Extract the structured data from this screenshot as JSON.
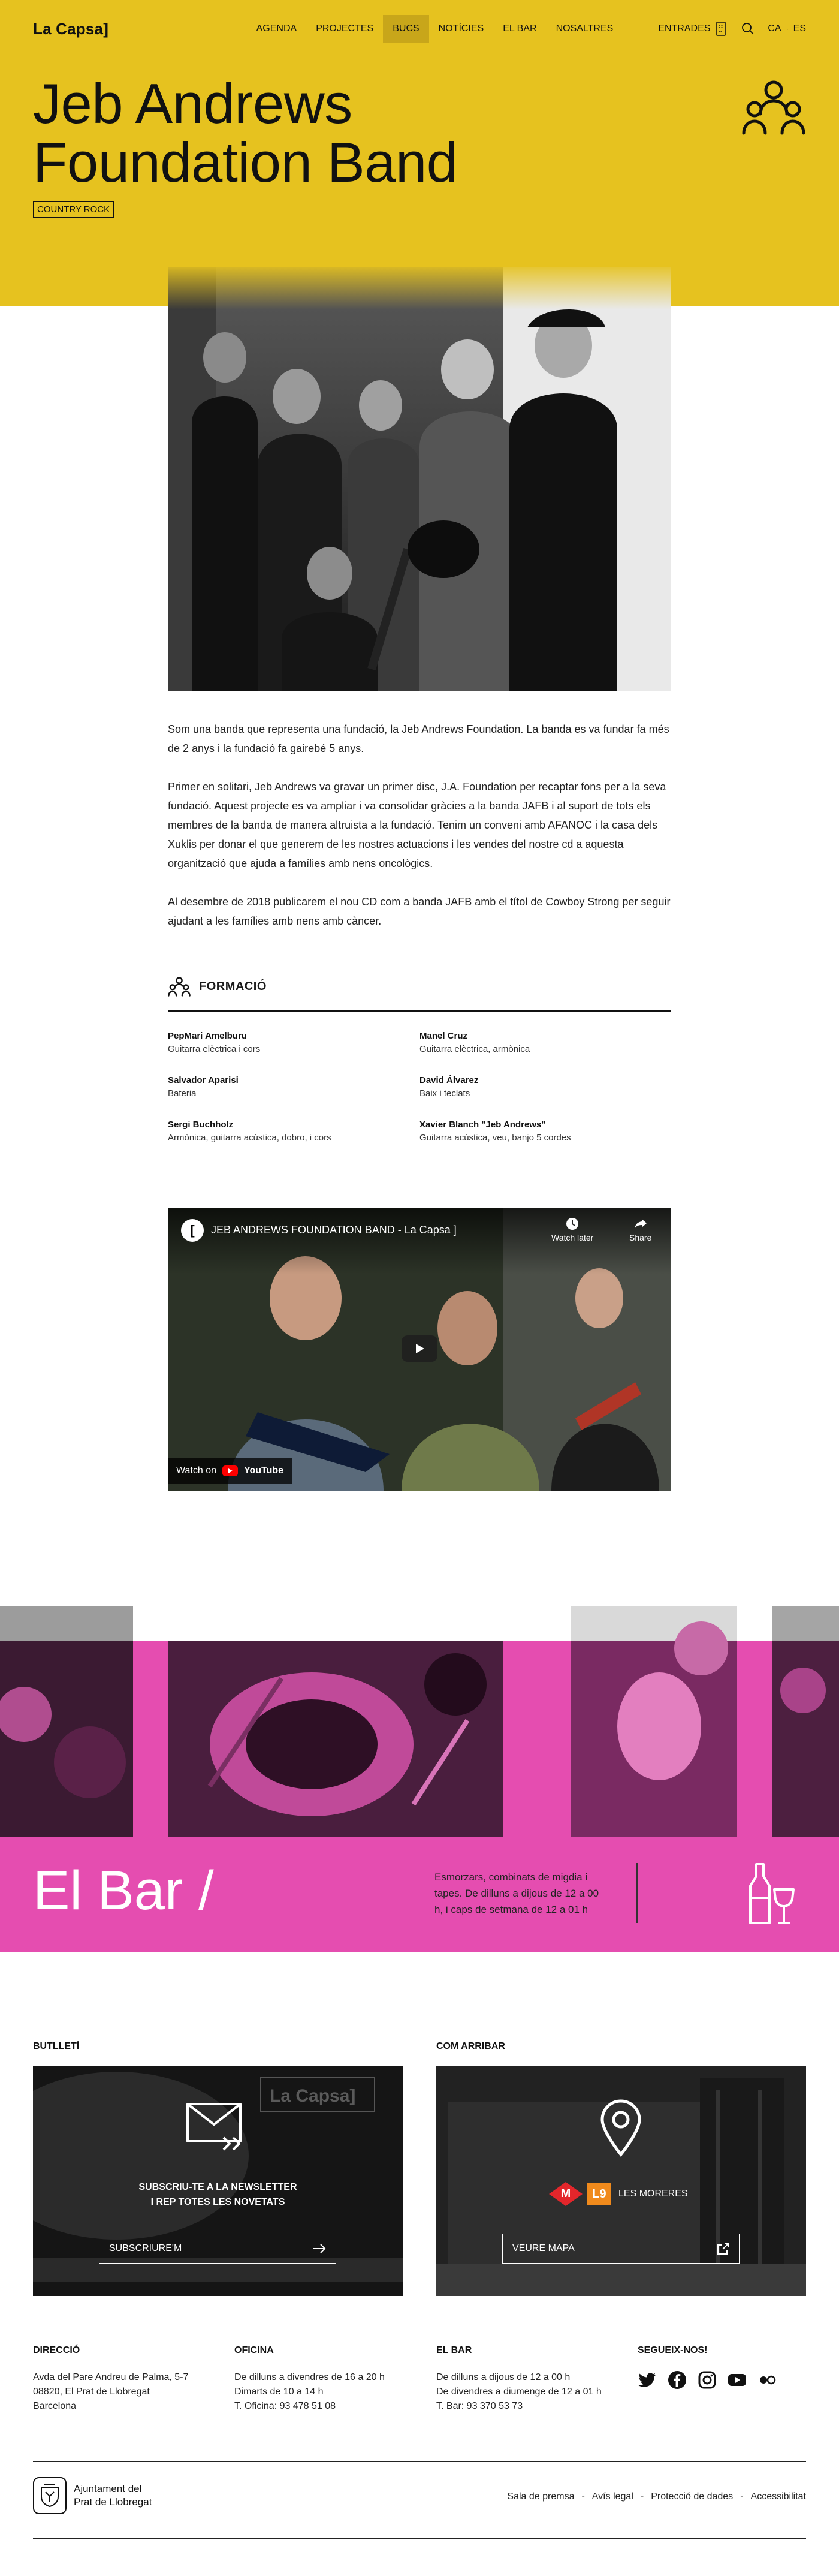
{
  "header": {
    "logo": "La Capsa]",
    "nav": [
      "AGENDA",
      "PROJECTES",
      "BUCS",
      "NOTÍCIES",
      "EL BAR",
      "NOSALTRES"
    ],
    "active_nav": "BUCS",
    "tickets_label": "ENTRADES",
    "lang_ca": "CA",
    "lang_sep": "·",
    "lang_es": "ES"
  },
  "hero": {
    "title_line1": "Jeb Andrews",
    "title_line2": "Foundation Band",
    "genre_tag": "COUNTRY ROCK"
  },
  "body": {
    "p1": "Som una banda que representa una fundació, la Jeb Andrews Foundation. La banda es va fundar fa més de 2 anys i la fundació fa gairebé 5 anys.",
    "p2": "Primer en solitari, Jeb Andrews va gravar un primer disc, J.A. Foundation per recaptar fons per a la seva fundació. Aquest projecte es va ampliar i va consolidar gràcies a la banda JAFB i al suport de tots els membres de la banda de manera altruista a la fundació. Tenim un conveni amb AFANOC i la casa dels Xuklis per donar el que generem de les nostres actuacions i les vendes del nostre cd a aquesta organització que ajuda a famílies amb nens oncològics.",
    "p3": "Al desembre de 2018 publicarem el nou CD com a banda JAFB amb el títol de Cowboy Strong per seguir ajudant a les famílies amb nens amb càncer."
  },
  "formacio": {
    "heading": "FORMACIÓ",
    "members": [
      {
        "name": "PepMari Amelburu",
        "role": "Guitarra elèctrica i cors"
      },
      {
        "name": "Manel Cruz",
        "role": "Guitarra elèctrica, armònica"
      },
      {
        "name": "Salvador Aparisi",
        "role": "Bateria"
      },
      {
        "name": "David Álvarez",
        "role": "Baix i teclats"
      },
      {
        "name": "Sergi Buchholz",
        "role": "Armònica, guitarra acústica, dobro, i cors"
      },
      {
        "name": "Xavier Blanch \"Jeb Andrews\"",
        "role": "Guitarra acústica, veu, banjo 5 cordes"
      }
    ]
  },
  "video": {
    "title": "JEB ANDREWS FOUNDATION BAND - La Capsa ]",
    "watch_later": "Watch later",
    "share": "Share",
    "watch_on": "Watch on",
    "youtube": "YouTube"
  },
  "el_bar": {
    "title": "El Bar /",
    "text": "Esmorzars, combinats de migdia i tapes. De dilluns a dijous de 12 a 00 h, i caps de setmana de 12 a 01 h",
    "icon": "bottle-glass-icon"
  },
  "newsletter": {
    "label": "BUTLLETÍ",
    "text_line1": "SUBSCRIU-TE A LA NEWSLETTER",
    "text_line2": "I REP TOTES LES NOVETATS",
    "button": "SUBSCRIURE'M",
    "bg_sign": "La Capsa]"
  },
  "arrival": {
    "label": "COM ARRIBAR",
    "metro": "M",
    "line": "L9",
    "stop": "LES MORERES",
    "button": "VEURE MAPA"
  },
  "footer": {
    "direccio": {
      "title": "DIRECCIÓ",
      "lines": [
        "Avda del Pare Andreu de Palma, 5-7",
        "08820, El Prat de Llobregat",
        "Barcelona"
      ]
    },
    "oficina": {
      "title": "OFICINA",
      "lines": [
        "De dilluns a divendres de 16 a 20 h",
        "Dimarts de 10 a 14 h",
        "T. Oficina: 93 478 51 08"
      ]
    },
    "bar": {
      "title": "EL BAR",
      "lines": [
        "De dilluns a dijous de 12 a 00 h",
        "De divendres a diumenge de 12 a 01 h",
        "T. Bar: 93 370 53 73"
      ]
    },
    "social": {
      "title": "SEGUEIX-NOS!",
      "icons": [
        "twitter-icon",
        "facebook-icon",
        "instagram-icon",
        "youtube-icon",
        "flickr-icon"
      ]
    },
    "city": {
      "line1": "Ajuntament del",
      "line2": "Prat de Llobregat"
    },
    "legal": [
      "Sala de premsa",
      "Avís legal",
      "Protecció de dades",
      "Accessibilitat"
    ],
    "legal_sep": "-"
  },
  "colors": {
    "yellow": "#e6c21f",
    "magenta": "#e54db0",
    "metro_red": "#e3262b",
    "l9_orange": "#f08a1c"
  }
}
